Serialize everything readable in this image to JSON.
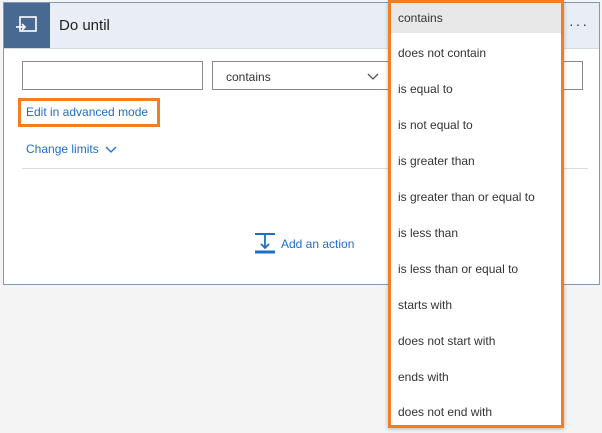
{
  "header": {
    "title": "Do until",
    "icon": "loop-icon",
    "more": "···"
  },
  "condition": {
    "left_value": "",
    "operator": "contains",
    "right_value": ""
  },
  "links": {
    "advanced_mode": "Edit in advanced mode",
    "change_limits": "Change limits",
    "add_action": "Add an action"
  },
  "dropdown": {
    "options": [
      {
        "label": "contains"
      },
      {
        "label": "does not contain"
      },
      {
        "label": "is equal to"
      },
      {
        "label": "is not equal to"
      },
      {
        "label": "is greater than"
      },
      {
        "label": "is greater than or equal to"
      },
      {
        "label": "is less than"
      },
      {
        "label": "is less than or equal to"
      },
      {
        "label": "starts with"
      },
      {
        "label": "does not start with"
      },
      {
        "label": "ends with"
      },
      {
        "label": "does not end with"
      }
    ],
    "selected": "contains"
  },
  "colors": {
    "accent": "#1e6ec8",
    "header_icon_bg": "#486991",
    "highlight": "#f47d20"
  }
}
